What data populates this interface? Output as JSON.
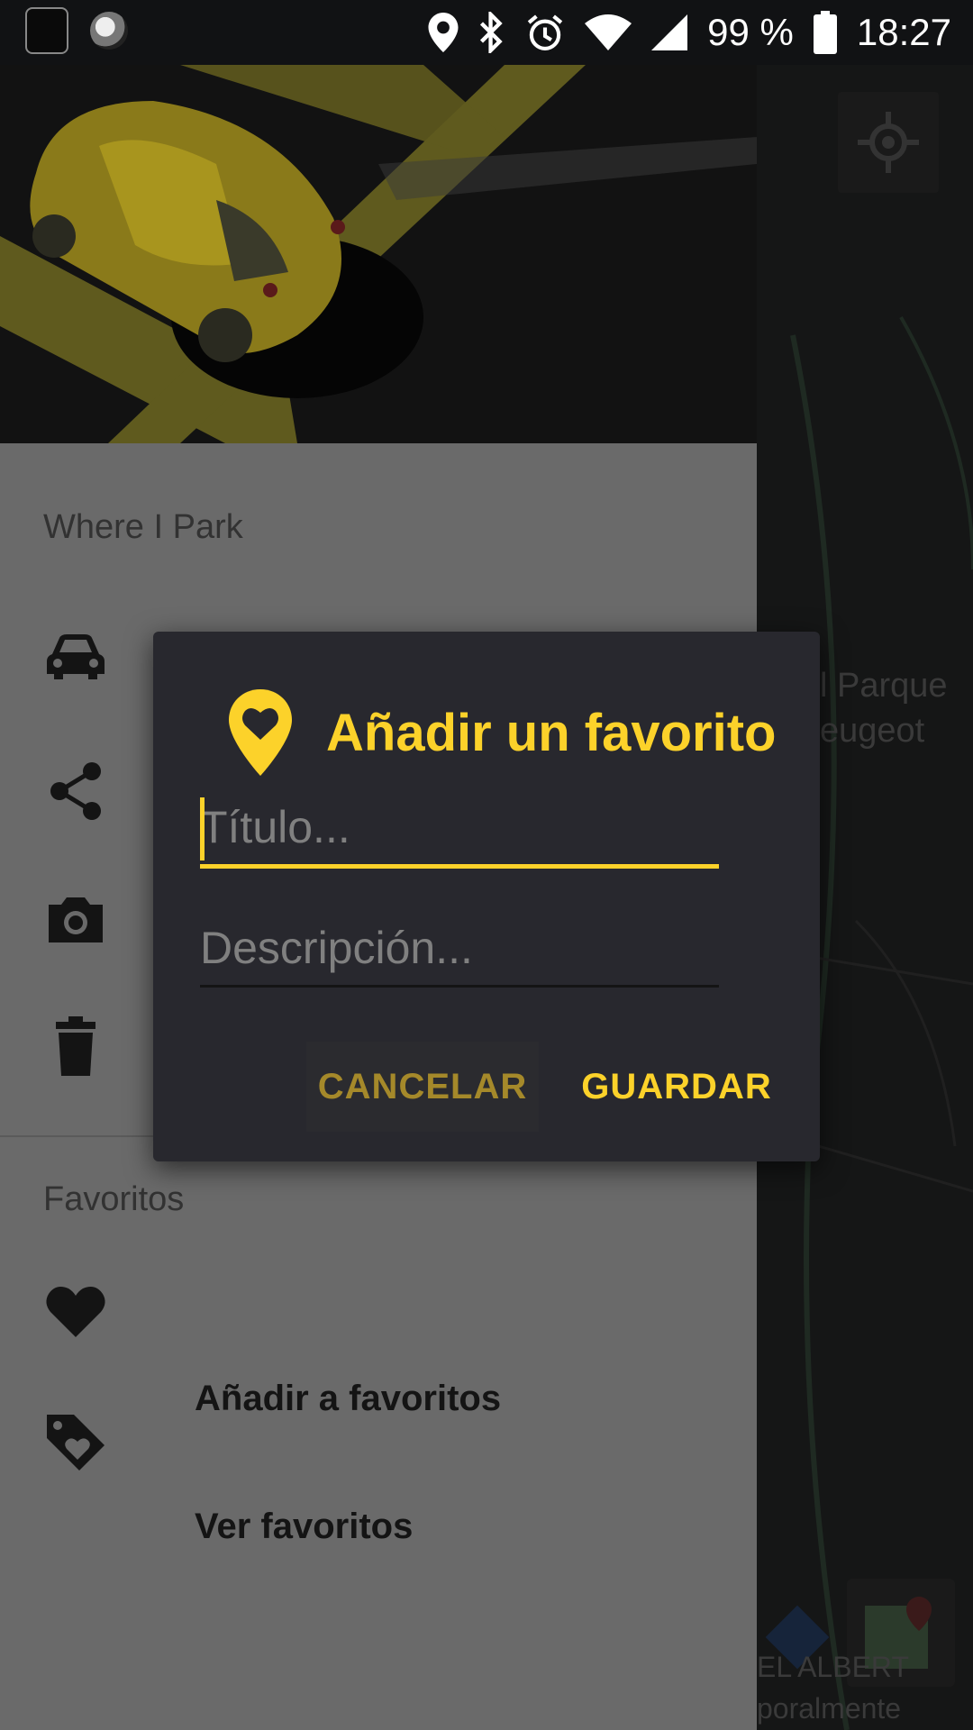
{
  "status_bar": {
    "battery_percent": "99 %",
    "time": "18:27"
  },
  "drawer": {
    "app_title": "Where I Park",
    "menu_icons": [
      "car-icon",
      "share-icon",
      "camera-icon",
      "trash-icon"
    ],
    "favorites_section": "Favoritos",
    "favorites_items": [
      {
        "icon": "heart-icon",
        "label": "Añadir a favoritos"
      },
      {
        "icon": "tag-heart-icon",
        "label": "Ver favoritos"
      }
    ]
  },
  "map": {
    "label_line1": "l Parque",
    "label_line2": "eugeot",
    "bottom_text_1": "EL ALBERT",
    "bottom_text_2": "poralmente"
  },
  "dialog": {
    "title": "Añadir un favorito",
    "title_field": {
      "value": "",
      "placeholder": "Título..."
    },
    "description_field": {
      "value": "",
      "placeholder": "Descripción..."
    },
    "cancel_label": "CANCELAR",
    "save_label": "GUARDAR"
  },
  "colors": {
    "accent": "#fcd22a",
    "dialog_bg": "#28282e",
    "drawer_bg_dimmed": "#6a6a6a"
  }
}
